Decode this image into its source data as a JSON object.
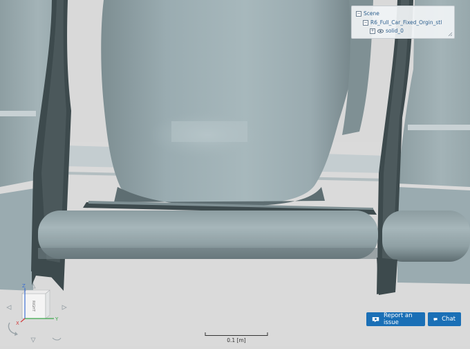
{
  "scene_tree": {
    "root_label": "Scene",
    "model_label": "R6_Full_Car_Fixed_Orgin_stl",
    "solid_label": "solid_0"
  },
  "nav_cube": {
    "face_label": "RIGHT",
    "axis_z": "Z",
    "axis_x": "X",
    "axis_y": "Y"
  },
  "scale_bar": {
    "label": "0.1 [m]"
  },
  "actions": {
    "report_label": "Report an issue",
    "chat_label": "Chat"
  },
  "colors": {
    "model_fill": "#9fb1b6",
    "model_dark": "#374447",
    "background": "#d9d9d9",
    "accent": "#1a6fb6",
    "tree_text": "#2d5f8e"
  },
  "icons": {
    "expand": "minus-box-icon",
    "eye": "eye-icon",
    "report": "report-icon",
    "chat": "chat-bubble-icon"
  }
}
